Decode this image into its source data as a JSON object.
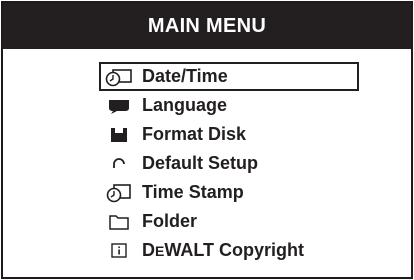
{
  "header": {
    "title": "MAIN MENU"
  },
  "menu": {
    "items": [
      {
        "label": "Date/Time",
        "icon": "clock-card-icon",
        "selected": true
      },
      {
        "label": "Language",
        "icon": "speech-bubble-icon",
        "selected": false
      },
      {
        "label": "Format Disk",
        "icon": "floppy-disk-icon",
        "selected": false
      },
      {
        "label": "Default Setup",
        "icon": "reset-arc-icon",
        "selected": false
      },
      {
        "label": "Time Stamp",
        "icon": "clock-stamp-icon",
        "selected": false
      },
      {
        "label": "Folder",
        "icon": "folder-icon",
        "selected": false
      },
      {
        "label": "DEWALT Copyright",
        "label_parts": [
          "D",
          "E",
          "WALT Copyright"
        ],
        "icon": "info-icon",
        "selected": false
      }
    ]
  },
  "colors": {
    "title_background": "#231f20",
    "title_text": "#ffffff",
    "text": "#231f20",
    "background": "#ffffff"
  }
}
